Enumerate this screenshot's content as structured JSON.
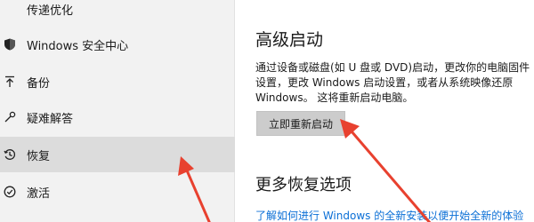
{
  "sidebar": {
    "items": [
      {
        "label": "传递优化",
        "icon": "delivery-icon"
      },
      {
        "label": "Windows 安全中心",
        "icon": "shield-icon"
      },
      {
        "label": "备份",
        "icon": "backup-arrow-icon"
      },
      {
        "label": "疑难解答",
        "icon": "wrench-icon"
      },
      {
        "label": "恢复",
        "icon": "recovery-clock-icon",
        "selected": true
      },
      {
        "label": "激活",
        "icon": "check-circle-icon"
      }
    ]
  },
  "main": {
    "advanced_startup": {
      "title": "高级启动",
      "description_lines": [
        "通过设备或磁盘(如 U 盘或 DVD)启动，更改你的电脑固件",
        "设置，更改 Windows 启动设置，或者从系统映像还原",
        "Windows。 这将重新启动电脑。"
      ],
      "button_label": "立即重新启动"
    },
    "more_options": {
      "title": "更多恢复选项",
      "link_text": "了解如何进行 Windows 的全新安装以便开始全新的体验"
    }
  },
  "colors": {
    "sidebar_bg": "#f2f2f2",
    "selected_bg": "#dcdcdc",
    "button_bg": "#cccccc",
    "link": "#0b6fd6",
    "annotation_arrow": "#e8412f"
  }
}
